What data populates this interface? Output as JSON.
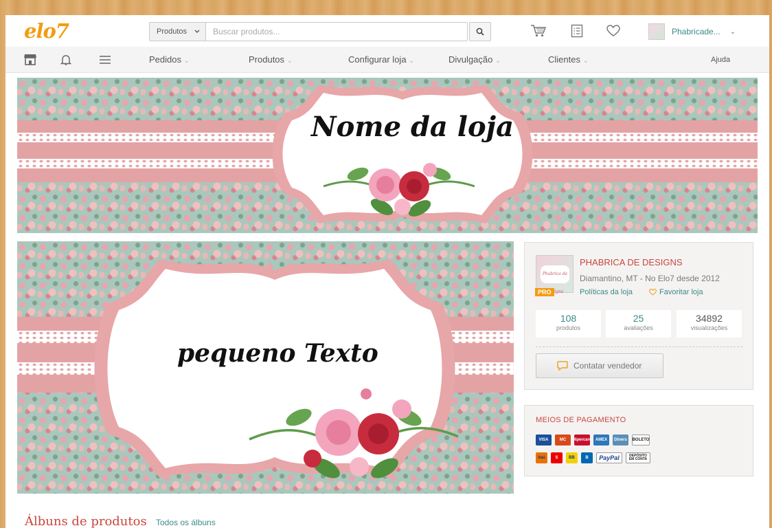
{
  "header": {
    "logo": "elo7",
    "search": {
      "category": "Produtos",
      "placeholder": "Buscar produtos..."
    },
    "user_name": "Phabricade..."
  },
  "nav": {
    "items": [
      {
        "label": "Pedidos"
      },
      {
        "label": "Produtos"
      },
      {
        "label": "Configurar loja"
      },
      {
        "label": "Divulgação"
      },
      {
        "label": "Clientes"
      }
    ],
    "help": "Ajuda"
  },
  "banner": {
    "title": "Nome da loja"
  },
  "cover": {
    "text": "pequeno Texto"
  },
  "store": {
    "thumb_text": "Phabrica de Designs",
    "badge": "PRO",
    "name": "PHABRICA DE DESIGNS",
    "location": "Diamantino, MT - No Elo7 desde 2012",
    "policies": "Políticas da loja",
    "favorite": "Favoritar loja",
    "stats": [
      {
        "value": "108",
        "label": "produtos"
      },
      {
        "value": "25",
        "label": "avaliações"
      },
      {
        "value": "34892",
        "label": "visualizações"
      }
    ],
    "contact": "Contatar vendedor"
  },
  "payments": {
    "title": "MEIOS DE PAGAMENTO",
    "row1": [
      {
        "label": "VISA",
        "color": "#1a4f9c"
      },
      {
        "label": "MC",
        "color": "#d84a1b"
      },
      {
        "label": "Hipercard",
        "color": "#c8102e"
      },
      {
        "label": "AMEX",
        "color": "#2e77bb"
      },
      {
        "label": "Diners",
        "color": "#5a8fb8"
      },
      {
        "label": "BOLETO",
        "color": "#ffffff"
      }
    ],
    "row2": [
      {
        "label": "itaú",
        "color": "#ec7000"
      },
      {
        "label": "S",
        "color": "#ec0000"
      },
      {
        "label": "BB",
        "color": "#f3d100"
      },
      {
        "label": "B",
        "color": "#0067b1"
      },
      {
        "label": "PayPal",
        "color": "#ffffff"
      },
      {
        "label": "DEPÓSITO EM CONTA",
        "color": "#ffffff"
      }
    ]
  },
  "albums": {
    "title": "Álbuns de produtos",
    "link": "Todos os álbuns"
  },
  "colors": {
    "accent_red": "#c9463d",
    "teal": "#3a8a87",
    "logo_orange": "#f39c12"
  }
}
